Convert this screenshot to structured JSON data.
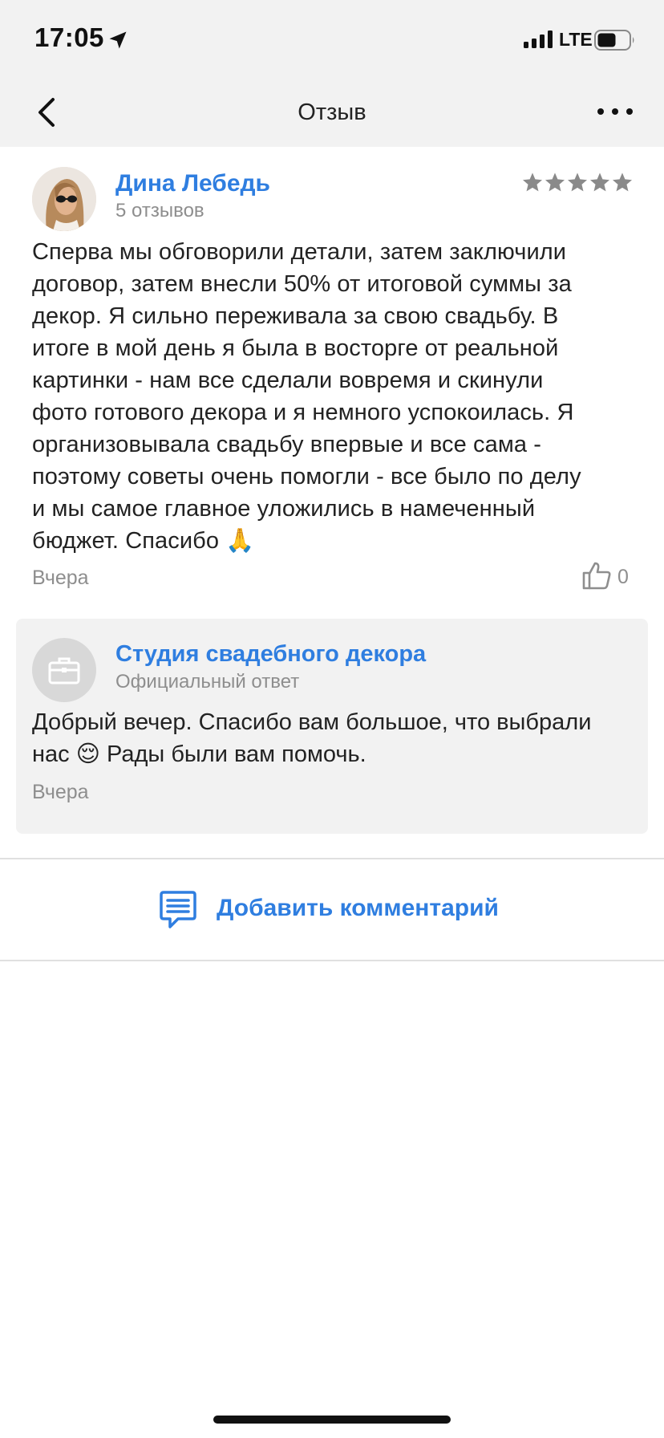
{
  "status_bar": {
    "time": "17:05",
    "network": "LTE",
    "icons": [
      "location-arrow-icon",
      "signal-bars-icon",
      "battery-icon"
    ]
  },
  "nav": {
    "title": "Отзыв",
    "back_icon": "chevron-left-icon",
    "more_icon": "more-dots-icon"
  },
  "review": {
    "author_name": "Дина Лебедь",
    "author_reviews": "5 отзывов",
    "rating": 5,
    "rating_max": 5,
    "lines": [
      "Сперва мы обговорили детали, затем заключили",
      "договор, затем внесли 50% от итоговой суммы за",
      "декор. Я сильно переживала за свою свадьбу. В",
      "итоге в мой день я была в восторге от реальной",
      "картинки - нам все сделали вовремя и скинули",
      "фото готового декора и я немного успокоилась. Я",
      "организовывала свадьбу впервые и все сама -",
      "поэтому советы очень помогли - все было по делу",
      "и мы самое главное уложились в намеченный",
      "бюджет. Спасибо 🙏"
    ],
    "date": "Вчера",
    "likes": "0",
    "like_icon": "thumbs-up-icon"
  },
  "reply": {
    "name": "Студия свадебного декора",
    "label": "Официальный ответ",
    "lines": [
      "Добрый вечер. Спасибо вам большое, что выбрали",
      "нас 😌 Рады были вам помочь."
    ],
    "date": "Вчера",
    "logo_icon": "briefcase-icon"
  },
  "add_comment": {
    "label": "Добавить комментарий",
    "icon": "comment-icon"
  },
  "colors": {
    "accent": "#2f7ee0",
    "header_bg": "#f2f2f2",
    "muted_text": "#8e8e8e",
    "star": "#8a8a8a"
  }
}
